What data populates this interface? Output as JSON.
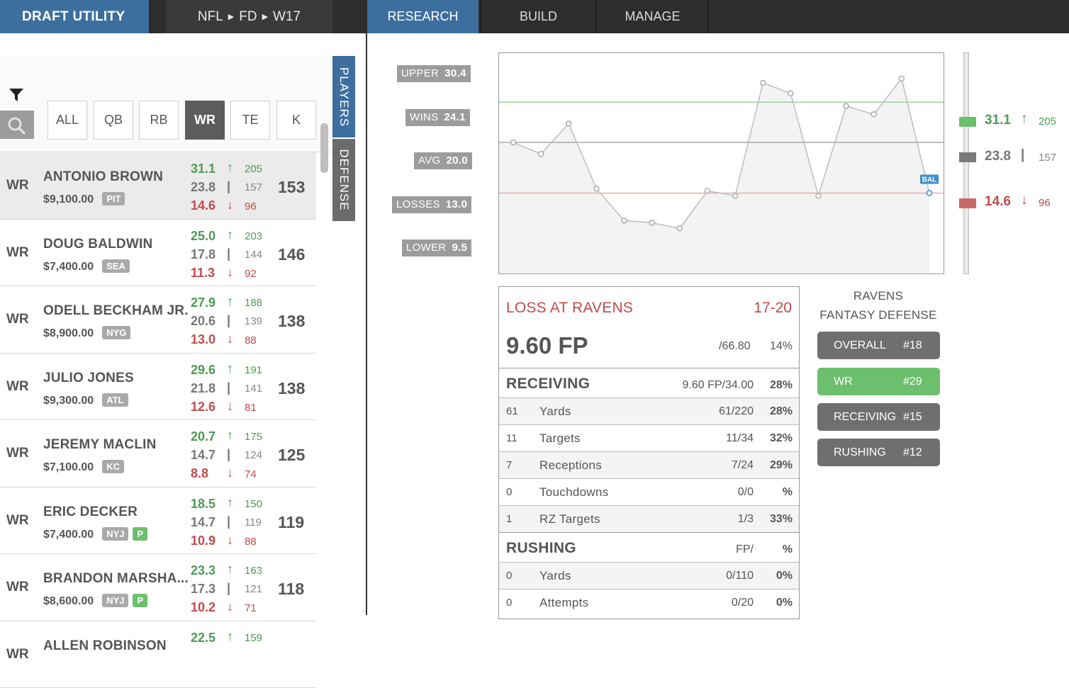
{
  "app": {
    "brand": "DRAFT UTILITY"
  },
  "breadcrumb": {
    "sport": "NFL",
    "site": "FD",
    "week": "W17",
    "sep": "▶"
  },
  "nav": [
    "RESEARCH",
    "BUILD",
    "MANAGE"
  ],
  "positions": [
    "ALL",
    "QB",
    "RB",
    "WR",
    "TE",
    "K"
  ],
  "active_position": "WR",
  "side_tabs": {
    "players": "PLAYERS",
    "defense": "DEFENSE"
  },
  "players": [
    {
      "pos": "WR",
      "name": "ANTONIO BROWN",
      "salary": "$9,100.00",
      "team": "PIT",
      "p": false,
      "high": "31.1",
      "high_rank": "205",
      "avg": "23.8",
      "avg_rank": "157",
      "low": "14.6",
      "low_rank": "96",
      "total": "153"
    },
    {
      "pos": "WR",
      "name": "DOUG BALDWIN",
      "salary": "$7,400.00",
      "team": "SEA",
      "p": false,
      "high": "25.0",
      "high_rank": "203",
      "avg": "17.8",
      "avg_rank": "144",
      "low": "11.3",
      "low_rank": "92",
      "total": "146"
    },
    {
      "pos": "WR",
      "name": "ODELL BECKHAM JR.",
      "salary": "$8,900.00",
      "team": "NYG",
      "p": false,
      "high": "27.9",
      "high_rank": "188",
      "avg": "20.6",
      "avg_rank": "139",
      "low": "13.0",
      "low_rank": "88",
      "total": "138"
    },
    {
      "pos": "WR",
      "name": "JULIO JONES",
      "salary": "$9,300.00",
      "team": "ATL",
      "p": false,
      "high": "29.6",
      "high_rank": "191",
      "avg": "21.8",
      "avg_rank": "141",
      "low": "12.6",
      "low_rank": "81",
      "total": "138"
    },
    {
      "pos": "WR",
      "name": "JEREMY MACLIN",
      "salary": "$7,100.00",
      "team": "KC",
      "p": false,
      "high": "20.7",
      "high_rank": "175",
      "avg": "14.7",
      "avg_rank": "124",
      "low": "8.8",
      "low_rank": "74",
      "total": "125"
    },
    {
      "pos": "WR",
      "name": "ERIC DECKER",
      "salary": "$7,400.00",
      "team": "NYJ",
      "p": true,
      "high": "18.5",
      "high_rank": "150",
      "avg": "14.7",
      "avg_rank": "119",
      "low": "10.9",
      "low_rank": "88",
      "total": "119"
    },
    {
      "pos": "WR",
      "name": "BRANDON MARSHA...",
      "salary": "$8,600.00",
      "team": "NYJ",
      "p": true,
      "high": "23.3",
      "high_rank": "163",
      "avg": "17.3",
      "avg_rank": "121",
      "low": "10.2",
      "low_rank": "71",
      "total": "118"
    },
    {
      "pos": "WR",
      "name": "ALLEN ROBINSON",
      "salary": "",
      "team": "",
      "p": false,
      "high": "22.5",
      "high_rank": "159",
      "avg": "",
      "avg_rank": "",
      "low": "",
      "low_rank": "",
      "total": ""
    }
  ],
  "p_badge": "P",
  "arrows": {
    "up": "↑",
    "mid": "|",
    "down": "↓"
  },
  "tiers": [
    {
      "label": "UPPER",
      "value": "30.4"
    },
    {
      "label": "WINS",
      "value": "24.1"
    },
    {
      "label": "AVG",
      "value": "20.0"
    },
    {
      "label": "LOSSES",
      "value": "13.0"
    },
    {
      "label": "LOWER",
      "value": "9.5"
    }
  ],
  "chart_data": {
    "type": "line",
    "y": [
      23.8,
      21.7,
      27.2,
      15.4,
      9.6,
      9.2,
      8.2,
      15.0,
      14.1,
      34.6,
      32.7,
      14.1,
      30.4,
      28.9,
      35.4,
      14.6
    ],
    "reference_lines": [
      {
        "name": "high",
        "value": 31.1,
        "color": "#8fd08f"
      },
      {
        "name": "avg",
        "value": 23.8,
        "color": "#a0a0a0"
      },
      {
        "name": "low",
        "value": 14.6,
        "color": "#e3a3a3"
      }
    ],
    "ylim": [
      0,
      40
    ],
    "highlight_label": "BAL",
    "line_color": "#bdbdbd",
    "fill_color": "#f3f3f3",
    "highlight_color": "#3d8ec9"
  },
  "range_readout": {
    "high": "31.1",
    "high_rank": "205",
    "avg": "23.8",
    "avg_rank": "157",
    "low": "14.6",
    "low_rank": "96"
  },
  "game": {
    "title": "LOSS AT RAVENS",
    "score": "17-20",
    "fp": "9.60 FP",
    "fp_of": "/66.80",
    "fp_pct": "14%",
    "receiving": {
      "label": "RECEIVING",
      "metric": "9.60 FP/34.00",
      "pct": "28%",
      "rows": [
        {
          "n": "61",
          "label": "Yards",
          "metric": "61/220",
          "pct": "28%"
        },
        {
          "n": "11",
          "label": "Targets",
          "metric": "11/34",
          "pct": "32%"
        },
        {
          "n": "7",
          "label": "Receptions",
          "metric": "7/24",
          "pct": "29%"
        },
        {
          "n": "0",
          "label": "Touchdowns",
          "metric": "0/0",
          "pct": "%"
        },
        {
          "n": "1",
          "label": "RZ Targets",
          "metric": "1/3",
          "pct": "33%"
        }
      ]
    },
    "rushing": {
      "label": "RUSHING",
      "metric": "FP/",
      "pct": "%",
      "rows": [
        {
          "n": "0",
          "label": "Yards",
          "metric": "0/110",
          "pct": "0%"
        },
        {
          "n": "0",
          "label": "Attempts",
          "metric": "0/20",
          "pct": "0%"
        }
      ]
    }
  },
  "defense": {
    "title_1": "RAVENS",
    "title_2": "FANTASY DEFENSE",
    "ranks": [
      {
        "label": "OVERALL",
        "rank": "#18",
        "highlight": false
      },
      {
        "label": "WR",
        "rank": "#29",
        "highlight": true
      },
      {
        "label": "RECEIVING",
        "rank": "#15",
        "highlight": false
      },
      {
        "label": "RUSHING",
        "rank": "#12",
        "highlight": false
      }
    ]
  }
}
